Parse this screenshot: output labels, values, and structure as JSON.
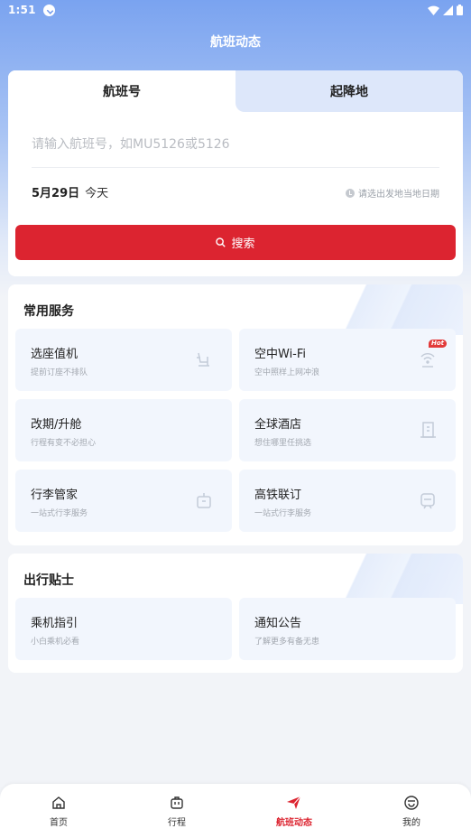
{
  "status_bar": {
    "time": "1:51"
  },
  "header": {
    "title": "航班动态"
  },
  "tabs": [
    {
      "label": "航班号",
      "active": true
    },
    {
      "label": "起降地",
      "active": false
    }
  ],
  "search": {
    "placeholder": "请输入航班号，如MU5126或5126",
    "date": "5月29日",
    "date_relative": "今天",
    "date_hint": "请选出发地当地日期",
    "button_label": "搜索"
  },
  "services": {
    "title": "常用服务",
    "items": [
      {
        "title": "选座值机",
        "subtitle": "提前订座不排队",
        "icon": "seat-icon"
      },
      {
        "title": "空中Wi-Fi",
        "subtitle": "空中照样上网冲浪",
        "icon": "wifi-icon",
        "badge": "Hot"
      },
      {
        "title": "改期/升舱",
        "subtitle": "行程有变不必担心",
        "icon": "none"
      },
      {
        "title": "全球酒店",
        "subtitle": "想住哪里任挑选",
        "icon": "hotel-icon"
      },
      {
        "title": "行李管家",
        "subtitle": "一站式行李服务",
        "icon": "luggage-icon"
      },
      {
        "title": "高铁联订",
        "subtitle": "一站式行李服务",
        "icon": "train-icon"
      }
    ]
  },
  "tips": {
    "title": "出行贴士",
    "items": [
      {
        "title": "乘机指引",
        "subtitle": "小白乘机必看"
      },
      {
        "title": "通知公告",
        "subtitle": "了解更多有备无患"
      }
    ]
  },
  "bottom_nav": [
    {
      "label": "首页",
      "icon": "home-icon",
      "active": false
    },
    {
      "label": "行程",
      "icon": "suitcase-icon",
      "active": false
    },
    {
      "label": "航班动态",
      "icon": "plane-icon",
      "active": true
    },
    {
      "label": "我的",
      "icon": "profile-icon",
      "active": false
    }
  ],
  "colors": {
    "accent": "#dc2430",
    "header_blue": "#7aa3f0",
    "tile_bg": "#f2f6fd"
  }
}
